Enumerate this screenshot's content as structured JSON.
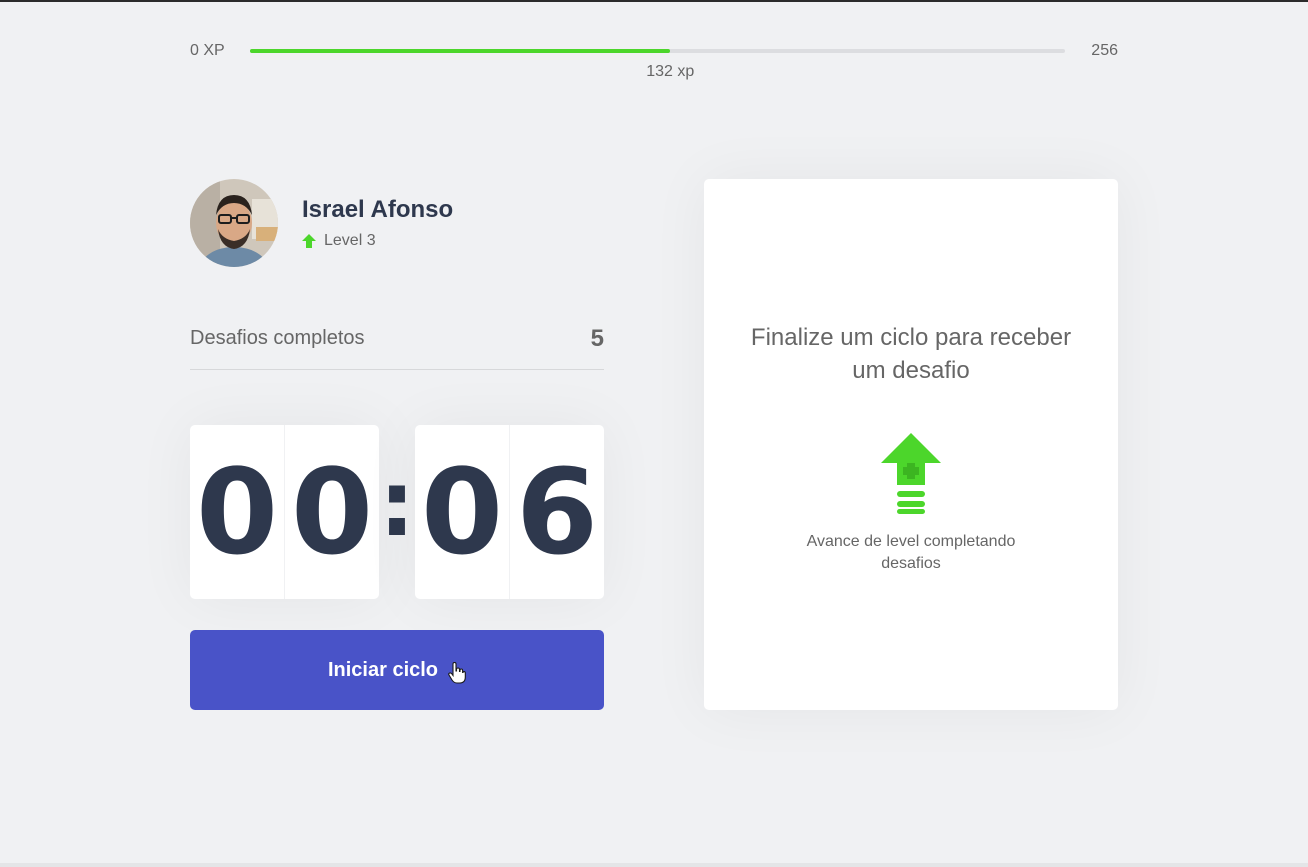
{
  "xp": {
    "min_label": "0 XP",
    "max_label": "256",
    "current_label": "132 xp",
    "current": 132,
    "max": 256,
    "fill_color": "#4cd62b"
  },
  "profile": {
    "name": "Israel Afonso",
    "level_label": "Level 3",
    "avatar": "user-photo"
  },
  "completed_challenges": {
    "label": "Desafios completos",
    "count": "5"
  },
  "countdown": {
    "minute_left": "0",
    "minute_right": "0",
    "separator": ":",
    "second_left": "0",
    "second_right": "6"
  },
  "start_button": {
    "label": "Iniciar ciclo",
    "color": "#4953c8"
  },
  "challenge_box": {
    "title": "Finalize um ciclo para receber um desafio",
    "description": "Avance de level completando desafios",
    "icon": "level-up-icon"
  }
}
